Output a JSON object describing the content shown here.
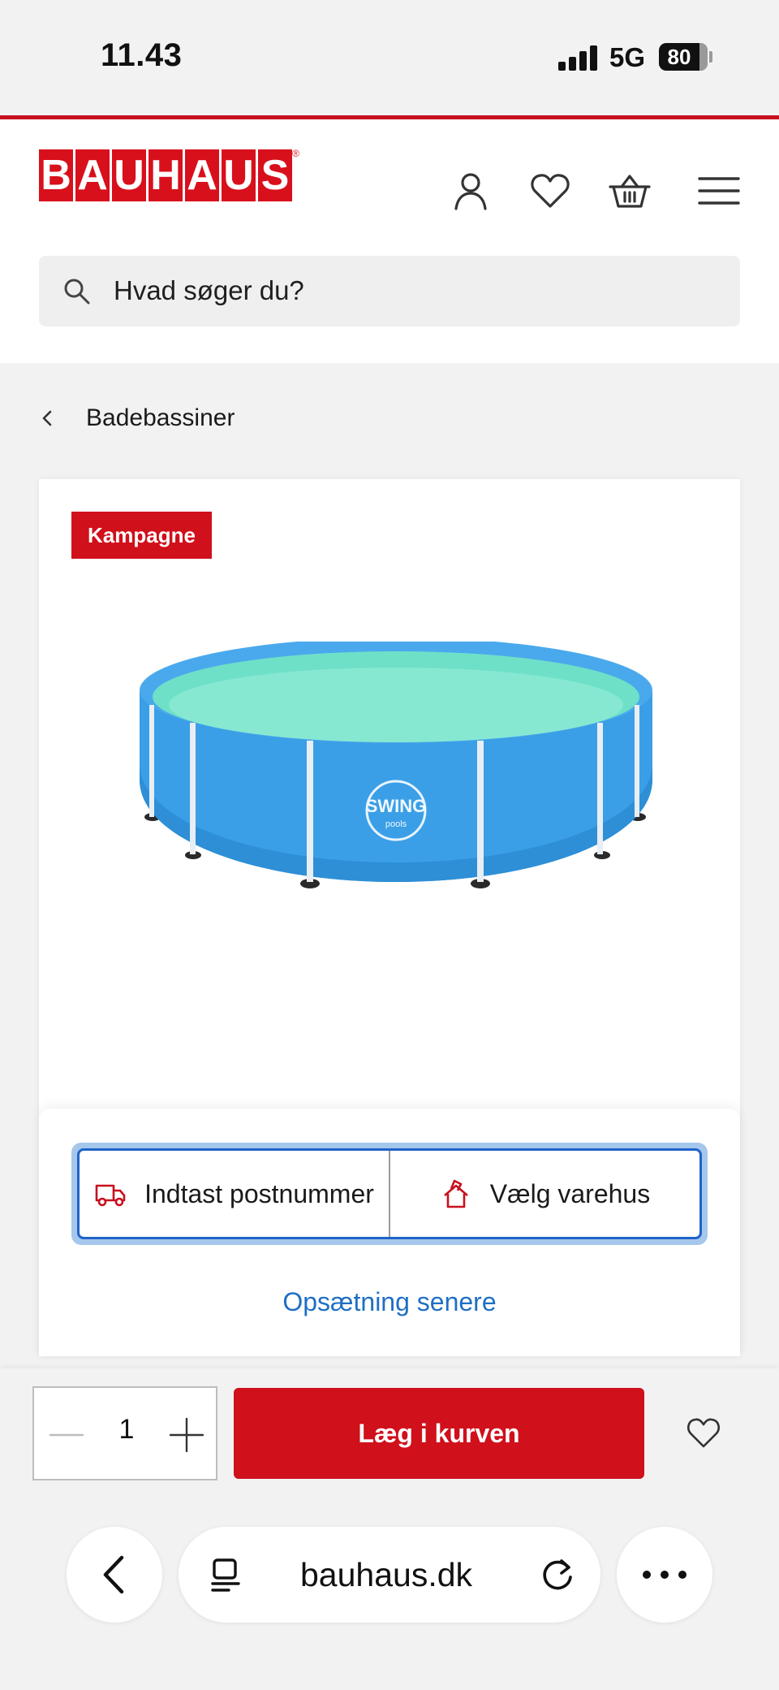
{
  "status_bar": {
    "time": "11.43",
    "network": "5G",
    "battery": "80"
  },
  "header": {
    "logo_letters": [
      "B",
      "A",
      "U",
      "H",
      "A",
      "U",
      "S"
    ],
    "logo_reg": "®",
    "icons": [
      "account-icon",
      "wishlist-heart-icon",
      "basket-icon",
      "menu-icon"
    ],
    "search_placeholder": "Hvad søger du?"
  },
  "breadcrumb": {
    "label": "Badebassiner"
  },
  "product": {
    "badge": "Kampagne",
    "image_logo_text": "SWING",
    "image_logo_sub": "pools"
  },
  "location": {
    "postcode_label": "Indtast postnummer",
    "store_label": "Vælg varehus",
    "later_link": "Opsætning senere"
  },
  "cart": {
    "quantity": "1",
    "add_button": "Læg i kurven"
  },
  "browser": {
    "domain": "bauhaus.dk"
  },
  "colors": {
    "brand_red": "#d0101b",
    "link_blue": "#1f6fc4",
    "focus_blue": "#1e64c8"
  }
}
